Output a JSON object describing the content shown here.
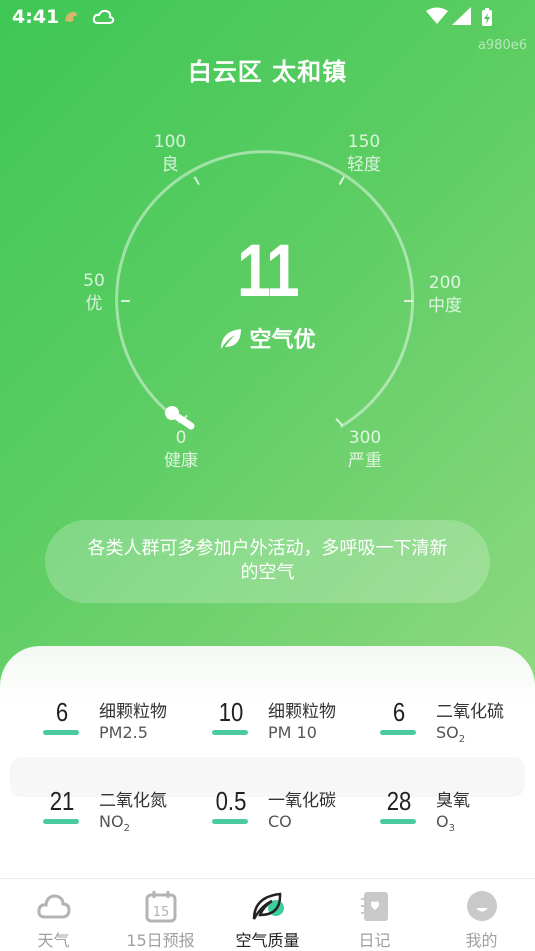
{
  "status_bar": {
    "time": "4:41"
  },
  "watermark": "a980e6",
  "location": "白云区 太和镇",
  "gauge": {
    "labels": [
      {
        "value": "0",
        "level": "健康"
      },
      {
        "value": "50",
        "level": "优"
      },
      {
        "value": "100",
        "level": "良"
      },
      {
        "value": "150",
        "level": "轻度"
      },
      {
        "value": "200",
        "level": "中度"
      },
      {
        "value": "300",
        "level": "严重"
      }
    ]
  },
  "aqi": {
    "value": "11",
    "status": "空气优"
  },
  "advice": "各类人群可多参加户外活动，多呼吸一下清新的空气",
  "pollutants": [
    {
      "value": "6",
      "name": "细颗粒物",
      "code": "PM2.5",
      "sub": ""
    },
    {
      "value": "10",
      "name": "细颗粒物",
      "code": "PM 10",
      "sub": ""
    },
    {
      "value": "6",
      "name": "二氧化硫",
      "code": "SO",
      "sub": "2"
    },
    {
      "value": "21",
      "name": "二氧化氮",
      "code": "NO",
      "sub": "2"
    },
    {
      "value": "0.5",
      "name": "一氧化碳",
      "code": "CO",
      "sub": ""
    },
    {
      "value": "28",
      "name": "臭氧",
      "code": "O",
      "sub": "3"
    }
  ],
  "tabs": [
    {
      "label": "天气",
      "icon": "cloud-icon",
      "active": false
    },
    {
      "label": "15日预报",
      "icon": "calendar-15-icon",
      "active": false
    },
    {
      "label": "空气质量",
      "icon": "leaf-icon",
      "active": true
    },
    {
      "label": "日记",
      "icon": "diary-icon",
      "active": false
    },
    {
      "label": "我的",
      "icon": "profile-icon",
      "active": false
    }
  ],
  "colors": {
    "hero_start": "#3ec755",
    "hero_end": "#8fd981",
    "bar": "#4bc9a0"
  }
}
